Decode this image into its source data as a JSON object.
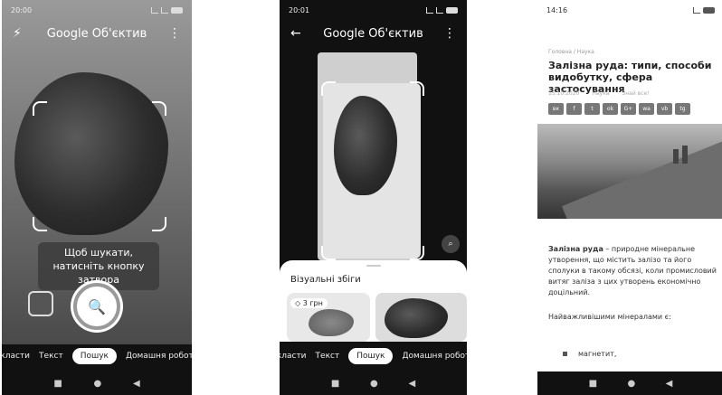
{
  "screen1": {
    "time": "20:00",
    "title": "Google Об'єктив",
    "hint": "Щоб шукати, натисніть кнопку затвора",
    "tabs": [
      "екласти",
      "Текст",
      "Пошук",
      "Домашня робота"
    ],
    "active_tab": "Пошук"
  },
  "screen2": {
    "time": "20:01",
    "title": "Google Об'єктив",
    "sheet_title": "Візуальні збіги",
    "price": "3 грн",
    "tabs": [
      "екласти",
      "Текст",
      "Пошук",
      "Домашня робота"
    ],
    "active_tab": "Пошук"
  },
  "screen3": {
    "time": "14:16",
    "breadcrumb": "Головна / Наука",
    "title": "Залізна руда: типи, способи видобутку, сфера застосування",
    "date": "15.10.2020",
    "category": "Наука",
    "meta_extra": "Знай все!",
    "share_icons": [
      "вк",
      "f",
      "t",
      "ok",
      "G+",
      "wa",
      "vb",
      "tg"
    ],
    "body_bold": "Залізна руда",
    "body_rest": " – природне мінеральне утворення, що містить залізо та його сполуки в такому обсязі, коли промисловий витяг заліза з цих утворень економічно доцільний.",
    "minerals_heading": "Найважливішими мінералами є:",
    "list_item": "магнетит,"
  },
  "nav_icons": [
    "square-icon",
    "circle-icon",
    "back-triangle-icon"
  ]
}
